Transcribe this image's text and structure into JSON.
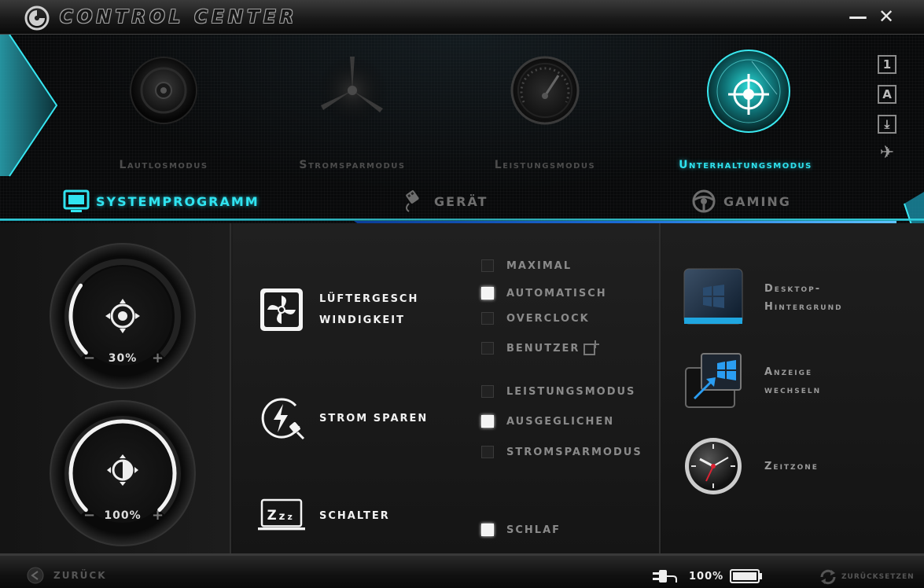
{
  "window": {
    "title": "CONTROL CENTER",
    "minimize_label": "—",
    "close_label": "✕"
  },
  "modes": [
    {
      "label": "Lautlosmodus",
      "icon": "speaker-icon",
      "active": false
    },
    {
      "label": "Stromsparmodus",
      "icon": "wind-turbine-icon",
      "active": false
    },
    {
      "label": "Leistungsmodus",
      "icon": "speedometer-icon",
      "active": false
    },
    {
      "label": "Unterhaltungsmodus",
      "icon": "crosshair-radar-icon",
      "active": true
    }
  ],
  "side_icons": [
    {
      "label": "1",
      "icon": "profile-one-icon"
    },
    {
      "label": "A",
      "icon": "text-a-icon"
    },
    {
      "label": "⤓",
      "icon": "download-icon"
    },
    {
      "label": "✈",
      "icon": "airplane-icon"
    }
  ],
  "tabs": [
    {
      "label": "SYSTEMPROGRAMM",
      "icon": "monitor-icon",
      "active": true
    },
    {
      "label": "GERÄT",
      "icon": "usb-plug-icon",
      "active": false
    },
    {
      "label": "GAMING",
      "icon": "steering-wheel-icon",
      "active": false
    }
  ],
  "dials": {
    "volume": {
      "value": "30%",
      "level": 0.3,
      "minus": "−",
      "plus": "+"
    },
    "brightness": {
      "value": "100%",
      "level": 1.0,
      "minus": "−",
      "plus": "+"
    }
  },
  "features": {
    "fan": {
      "line1": "LÜFTERGESCH",
      "line2": "WINDIGKEIT",
      "icon": "fan-icon"
    },
    "power": {
      "label": "STROM SPAREN",
      "icon": "power-saving-icon"
    },
    "switch": {
      "label": "SCHALTER",
      "icon": "sleep-laptop-icon"
    }
  },
  "fan_options": [
    {
      "label": "MAXIMAL",
      "checked": false
    },
    {
      "label": "AUTOMATISCH",
      "checked": true
    },
    {
      "label": "OVERCLOCK",
      "checked": false
    },
    {
      "label": "BENUTZER",
      "checked": false
    }
  ],
  "power_options": [
    {
      "label": "LEISTUNGSMODUS",
      "checked": false
    },
    {
      "label": "AUSGEGLICHEN",
      "checked": true
    },
    {
      "label": "STROMSPARMODUS",
      "checked": false
    }
  ],
  "switch_options": [
    {
      "label": "SCHLAF",
      "checked": true
    }
  ],
  "right_links": [
    {
      "line1": "Desktop-",
      "line2": "Hintergrund",
      "icon": "windows-desktop-icon"
    },
    {
      "line1": "Anzeige",
      "line2": "wechseln",
      "icon": "switch-display-icon"
    },
    {
      "line1": "Zeitzone",
      "line2": "",
      "icon": "clock-icon"
    }
  ],
  "footer": {
    "back_label": "ZURÜCK",
    "battery_text": "100%",
    "battery_level": 1.0,
    "reset_label": "ZURÜCKSETZEN"
  },
  "colors": {
    "accent": "#30e4f0",
    "inactive_text": "#4c4c4c",
    "checked": "#f4f4f4"
  }
}
